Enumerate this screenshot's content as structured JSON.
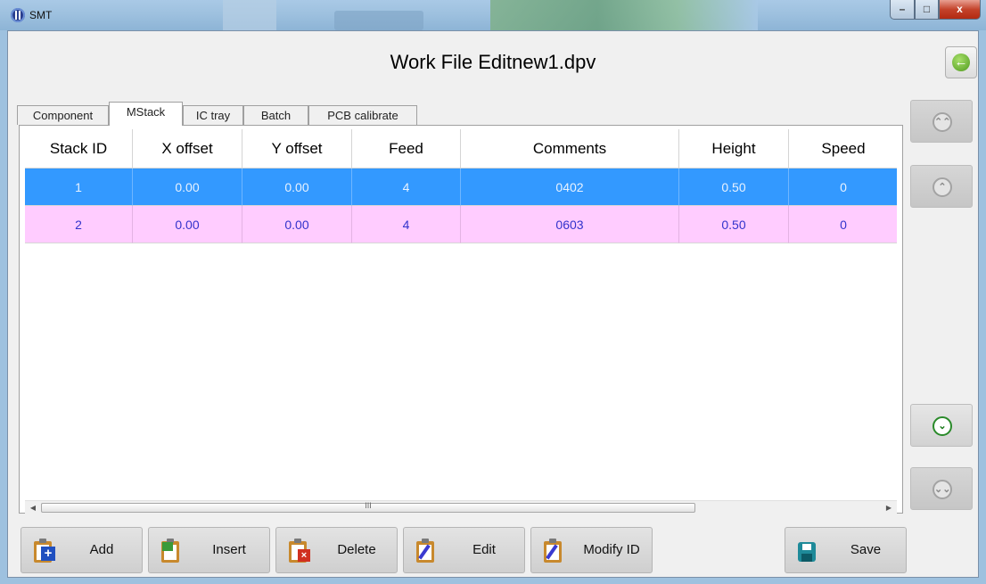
{
  "window": {
    "app_title": "SMT",
    "min_glyph": "–",
    "max_glyph": "□",
    "close_glyph": "x"
  },
  "header": {
    "title": "Work File Editnew1.dpv",
    "back_icon": "arrow-left-circle-icon",
    "back_glyph": "←"
  },
  "tabs": [
    {
      "label": "Component",
      "active": false
    },
    {
      "label": "MStack",
      "active": true
    },
    {
      "label": "IC tray",
      "active": false
    },
    {
      "label": "Batch",
      "active": false
    },
    {
      "label": "PCB calibrate",
      "active": false
    }
  ],
  "table": {
    "columns": [
      "Stack ID",
      "X offset",
      "Y offset",
      "Feed",
      "Comments",
      "Height",
      "Speed"
    ],
    "rows": [
      {
        "cells": [
          "1",
          "0.00",
          "0.00",
          "4",
          "0402",
          "0.50",
          "0"
        ],
        "state": "selected"
      },
      {
        "cells": [
          "2",
          "0.00",
          "0.00",
          "4",
          "0603",
          "0.50",
          "0"
        ],
        "state": "highlight"
      }
    ],
    "colors": {
      "selected_bg": "#3399ff",
      "highlight_bg": "#ffccff",
      "highlight_text": "#3333cc"
    }
  },
  "scrollbar": {
    "left_arrow": "◀",
    "right_arrow": "▶",
    "grip": "III"
  },
  "nav": {
    "page_up_glyph": "⌃⌃",
    "line_up_glyph": "⌃",
    "line_down_glyph": "⌄",
    "page_down_glyph": "⌄⌄"
  },
  "toolbar": {
    "add": "Add",
    "insert": "Insert",
    "delete": "Delete",
    "edit": "Edit",
    "modify_id": "Modify ID",
    "save": "Save"
  }
}
